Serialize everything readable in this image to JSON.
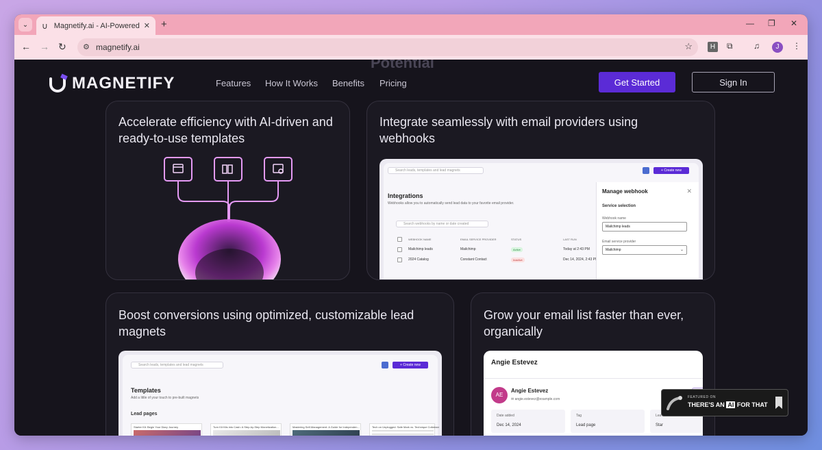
{
  "browser": {
    "tab_title": "Magnetify.ai - AI-Powered Lead",
    "url": "magnetify.ai",
    "avatar_initial": "J",
    "ext_h": "H"
  },
  "nav": {
    "brand": "MAGNETIFY",
    "links": [
      "Features",
      "How It Works",
      "Benefits",
      "Pricing"
    ],
    "get_started": "Get Started",
    "sign_in": "Sign In",
    "ghost_heading": "Potential"
  },
  "cards": {
    "templates": {
      "title": "Accelerate efficiency with AI-driven and ready-to-use templates"
    },
    "webhooks": {
      "title": "Integrate seamlessly with email providers using webhooks",
      "search_placeholder": "Search leads, templates and lead magnets",
      "create_new": "+ Create new",
      "page_title": "Integrations",
      "page_sub": "Webhooks allow you to automatically send lead data to your favorite email provider.",
      "table_search": "Search webhooks by name or date created",
      "columns": [
        "WEBHOOK NAME",
        "EMAIL SERVICE PROVIDER",
        "STATUS",
        "LAST RUN"
      ],
      "rows": [
        {
          "name": "Mailchimp leads",
          "provider": "Mailchimp",
          "status": "Active",
          "last_run": "Today at 2:43 PM"
        },
        {
          "name": "2024 Catalog",
          "provider": "Constant Contact",
          "status": "Inactive",
          "last_run": "Dec 14, 2024, 2:43 PM"
        }
      ],
      "panel": {
        "title": "Manage webhook",
        "section": "Service selection",
        "name_label": "Webhook name",
        "name_value": "Mailchimp leads",
        "provider_label": "Email service provider",
        "provider_value": "Mailchimp"
      }
    },
    "lead_magnets": {
      "title": "Boost conversions using optimized, customizable lead magnets",
      "search_placeholder": "Search leads, templates and lead magnets",
      "create_new": "+ Create new",
      "page_title": "Templates",
      "page_sub": "Add a little of your touch to pre-built magnets",
      "section": "Lead pages",
      "thumbs": [
        "Starter Kit: Begin Your Diary Journey",
        "Turn Kit Kits into Cash: A Step-by-Step Monetization...",
        "Mastering Self-Management: A Guide for Independen...",
        "Tech on Unplugged: Safe Mark vs. Technique Collaborati..."
      ]
    },
    "email_list": {
      "title": "Grow your email list faster than ever, organically",
      "header_name": "Angie Estevez",
      "avatar_initials": "AE",
      "contact_name": "Angie Estevez",
      "contact_email": "angie.estevez@example.com",
      "action": "De",
      "fields": [
        {
          "label": "Date added",
          "value": "Dec 14, 2024"
        },
        {
          "label": "Tag",
          "value": "Lead page"
        },
        {
          "label": "Lea",
          "value": "Star"
        }
      ]
    }
  },
  "badge": {
    "line1": "FEATURED ON",
    "line2a": "THERE'S AN",
    "line2b": "AI",
    "line2c": "FOR THAT"
  },
  "colors": {
    "accent": "#5b2bd6",
    "page_bg": "#16141c",
    "tab_bar": "#f2a6b9"
  }
}
